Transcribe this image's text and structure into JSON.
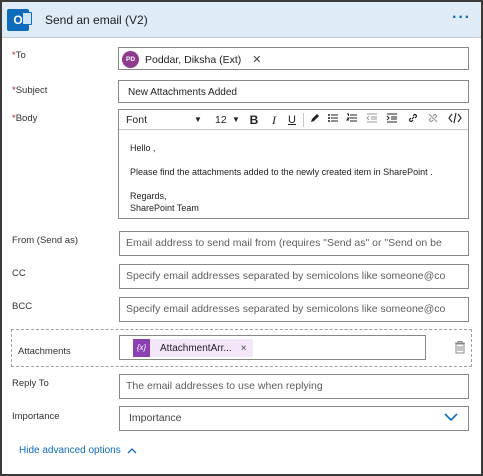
{
  "header": {
    "title": "Send an email (V2)",
    "app_icon": "outlook-icon",
    "more_label": "···"
  },
  "to": {
    "label": "To",
    "required_mark": "*",
    "recipient": {
      "initials": "PD",
      "name": "Poddar, Diksha (Ext)",
      "avatar_color": "#8e3a8e"
    },
    "remove_label": "✕"
  },
  "subject": {
    "label": "Subject",
    "required_mark": "*",
    "value": "New Attachments Added"
  },
  "body": {
    "label": "Body",
    "required_mark": "*",
    "toolbar": {
      "font": "Font",
      "size": "12",
      "bold": "B",
      "italic": "I",
      "underline": "U",
      "icons": [
        "pen-icon",
        "bullet-list-icon",
        "numbered-list-icon",
        "outdent-icon",
        "indent-icon",
        "link-icon",
        "unlink-icon",
        "code-view-icon"
      ]
    },
    "lines": [
      "Hello ,",
      "",
      "Please find the attachments added to the newly created item in SharePoint .",
      "",
      "Regards,",
      "SharePoint Team"
    ]
  },
  "from": {
    "label": "From (Send as)",
    "placeholder": "Email address to send mail from (requires \"Send as\" or \"Send on be"
  },
  "cc": {
    "label": "CC",
    "placeholder": "Specify email addresses separated by semicolons like someone@co"
  },
  "bcc": {
    "label": "BCC",
    "placeholder": "Specify email addresses separated by semicolons like someone@co"
  },
  "attachments": {
    "label": "Attachments",
    "token_icon": "{x}",
    "token_name": "AttachmentArr...",
    "remove_label": "×",
    "token_color": "#8c3fb1"
  },
  "reply_to": {
    "label": "Reply To",
    "placeholder": "The email addresses to use when replying"
  },
  "importance": {
    "label": "Importance",
    "value": "Importance"
  },
  "footer": {
    "hide_advanced": "Hide advanced options"
  },
  "colors": {
    "accent": "#0f6cbd",
    "header_bg": "#dfebf6",
    "required": "#a4262c"
  }
}
